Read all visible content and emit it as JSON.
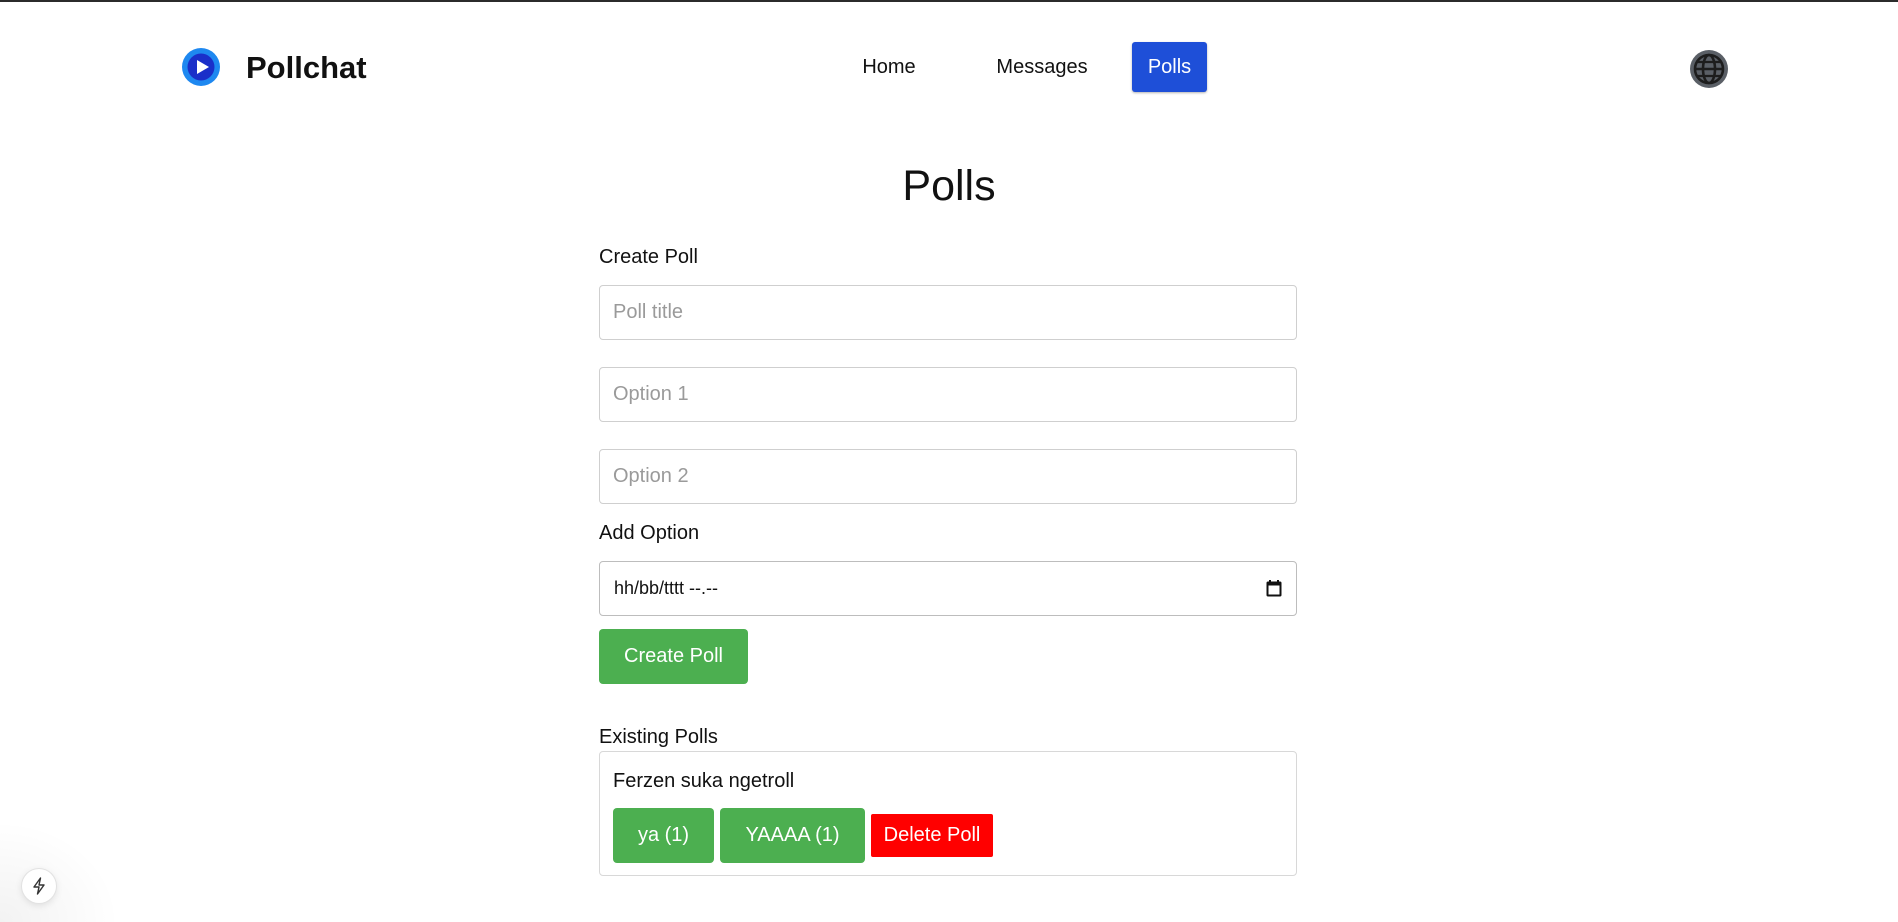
{
  "header": {
    "brand": "Pollchat",
    "nav": [
      {
        "label": "Home",
        "active": false
      },
      {
        "label": "Messages",
        "active": false
      },
      {
        "label": "Polls",
        "active": true
      }
    ],
    "icons": {
      "logo": "play-circle-logo",
      "language": "globe-icon"
    }
  },
  "main": {
    "title": "Polls",
    "create": {
      "label": "Create Poll",
      "title_placeholder": "Poll title",
      "option_placeholders": [
        "Option 1",
        "Option 2"
      ],
      "add_option_label": "Add Option",
      "datetime_value": "hh/bb/tttt --.--",
      "submit_label": "Create Poll"
    },
    "existing": {
      "label": "Existing Polls",
      "polls": [
        {
          "title": "Ferzen suka ngetroll",
          "options": [
            "ya (1)",
            "YAAAA (1)"
          ],
          "delete_label": "Delete Poll"
        }
      ]
    }
  },
  "colors": {
    "accent": "#1e4fd8",
    "success": "#4caf50",
    "danger": "#ff0000"
  }
}
